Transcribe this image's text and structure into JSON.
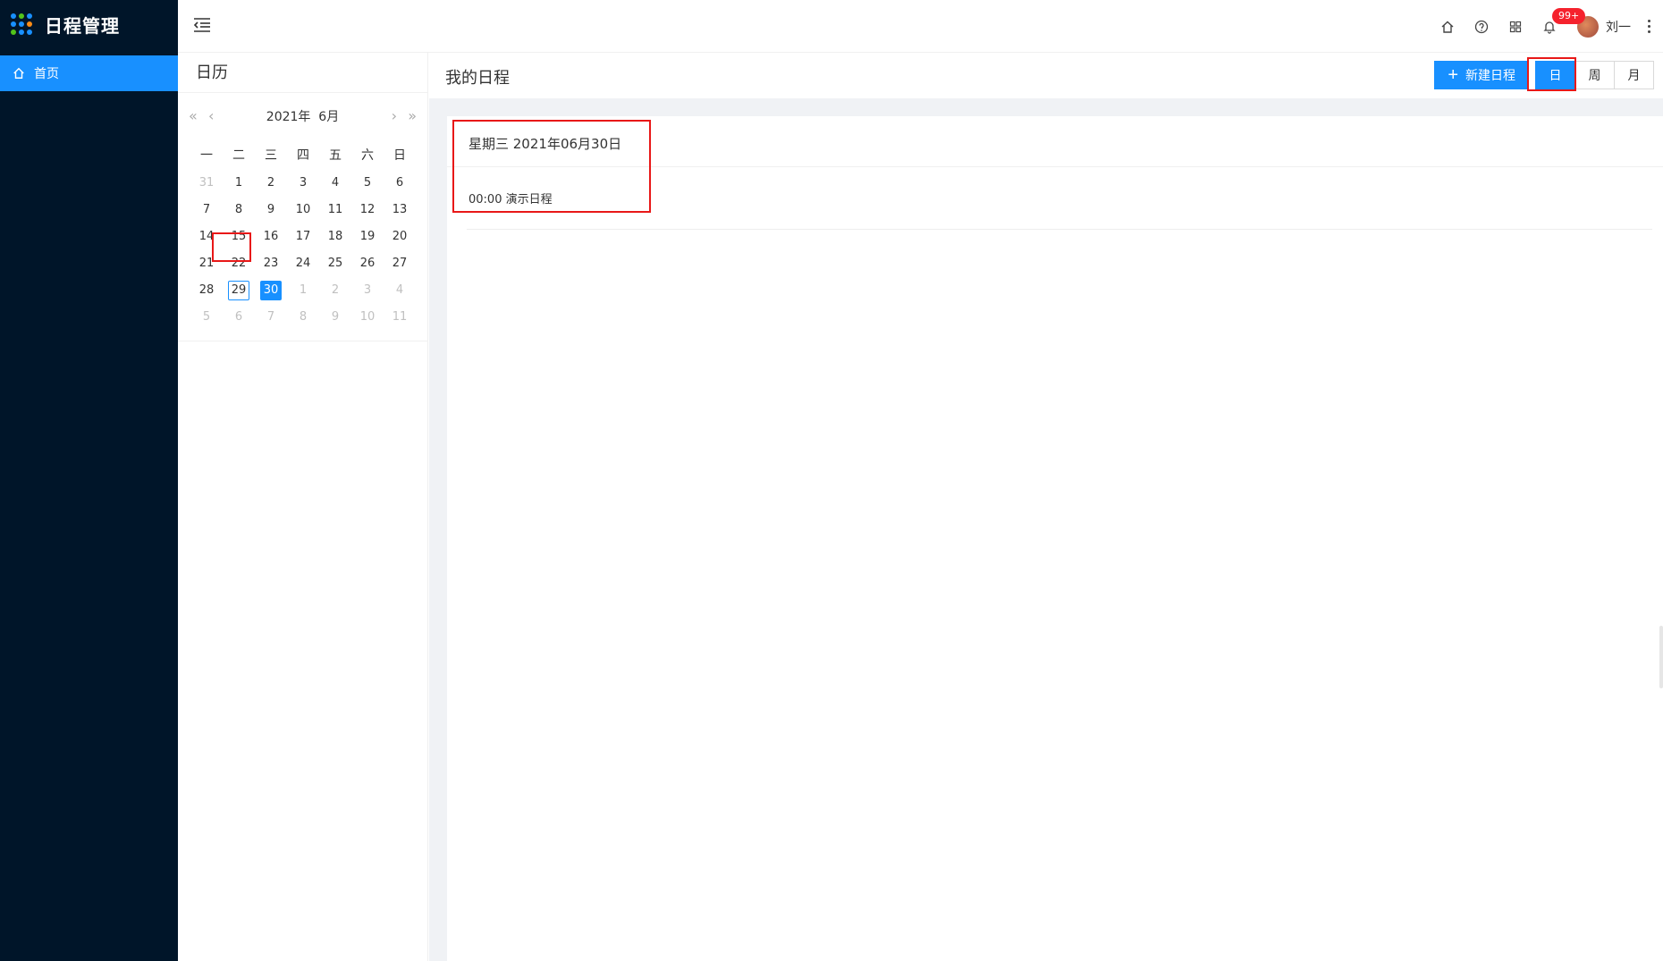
{
  "app": {
    "title": "日程管理"
  },
  "colors": {
    "sidebar": "#001529",
    "primary": "#1890ff",
    "highlight": "#e81818"
  },
  "sidebar": {
    "items": [
      {
        "label": "首页",
        "icon": "home-icon",
        "active": true
      }
    ]
  },
  "header": {
    "icons": [
      "home-icon",
      "help-icon",
      "apps-icon",
      "bell-icon"
    ],
    "notification_badge": "99+",
    "user_name": "刘一"
  },
  "calendar_panel": {
    "title": "日历",
    "month_label": "2021年  6月",
    "weekdays": [
      "一",
      "二",
      "三",
      "四",
      "五",
      "六",
      "日"
    ],
    "weeks": [
      [
        {
          "d": "31",
          "other": true
        },
        {
          "d": "1"
        },
        {
          "d": "2"
        },
        {
          "d": "3"
        },
        {
          "d": "4"
        },
        {
          "d": "5"
        },
        {
          "d": "6"
        }
      ],
      [
        {
          "d": "7"
        },
        {
          "d": "8"
        },
        {
          "d": "9"
        },
        {
          "d": "10"
        },
        {
          "d": "11"
        },
        {
          "d": "12"
        },
        {
          "d": "13"
        }
      ],
      [
        {
          "d": "14"
        },
        {
          "d": "15"
        },
        {
          "d": "16"
        },
        {
          "d": "17"
        },
        {
          "d": "18"
        },
        {
          "d": "19"
        },
        {
          "d": "20"
        }
      ],
      [
        {
          "d": "21"
        },
        {
          "d": "22"
        },
        {
          "d": "23"
        },
        {
          "d": "24"
        },
        {
          "d": "25"
        },
        {
          "d": "26"
        },
        {
          "d": "27"
        }
      ],
      [
        {
          "d": "28"
        },
        {
          "d": "29",
          "today": true
        },
        {
          "d": "30",
          "selected": true
        },
        {
          "d": "1",
          "other": true
        },
        {
          "d": "2",
          "other": true
        },
        {
          "d": "3",
          "other": true
        },
        {
          "d": "4",
          "other": true
        }
      ],
      [
        {
          "d": "5",
          "other": true
        },
        {
          "d": "6",
          "other": true
        },
        {
          "d": "7",
          "other": true
        },
        {
          "d": "8",
          "other": true
        },
        {
          "d": "9",
          "other": true
        },
        {
          "d": "10",
          "other": true
        },
        {
          "d": "11",
          "other": true
        }
      ]
    ]
  },
  "main": {
    "title": "我的日程",
    "new_button": "新建日程",
    "views": [
      {
        "label": "日",
        "active": true
      },
      {
        "label": "周"
      },
      {
        "label": "月"
      }
    ],
    "date_title": "星期三 2021年06月30日",
    "events": [
      {
        "time": "00:00",
        "name": "演示日程"
      }
    ]
  }
}
